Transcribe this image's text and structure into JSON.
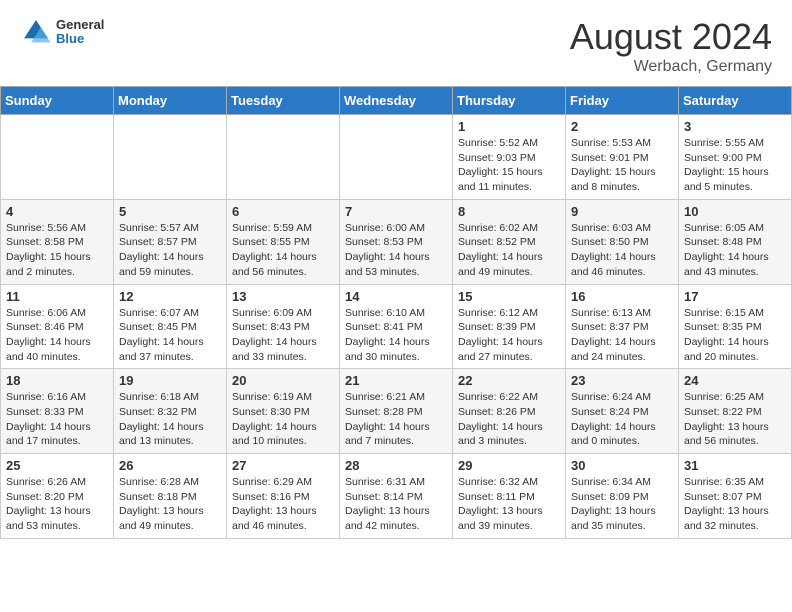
{
  "header": {
    "logo": {
      "general": "General",
      "blue": "Blue"
    },
    "month_year": "August 2024",
    "location": "Werbach, Germany"
  },
  "days_of_week": [
    "Sunday",
    "Monday",
    "Tuesday",
    "Wednesday",
    "Thursday",
    "Friday",
    "Saturday"
  ],
  "weeks": [
    [
      {
        "day": "",
        "info": ""
      },
      {
        "day": "",
        "info": ""
      },
      {
        "day": "",
        "info": ""
      },
      {
        "day": "",
        "info": ""
      },
      {
        "day": "1",
        "info": "Sunrise: 5:52 AM\nSunset: 9:03 PM\nDaylight: 15 hours and 11 minutes."
      },
      {
        "day": "2",
        "info": "Sunrise: 5:53 AM\nSunset: 9:01 PM\nDaylight: 15 hours and 8 minutes."
      },
      {
        "day": "3",
        "info": "Sunrise: 5:55 AM\nSunset: 9:00 PM\nDaylight: 15 hours and 5 minutes."
      }
    ],
    [
      {
        "day": "4",
        "info": "Sunrise: 5:56 AM\nSunset: 8:58 PM\nDaylight: 15 hours and 2 minutes."
      },
      {
        "day": "5",
        "info": "Sunrise: 5:57 AM\nSunset: 8:57 PM\nDaylight: 14 hours and 59 minutes."
      },
      {
        "day": "6",
        "info": "Sunrise: 5:59 AM\nSunset: 8:55 PM\nDaylight: 14 hours and 56 minutes."
      },
      {
        "day": "7",
        "info": "Sunrise: 6:00 AM\nSunset: 8:53 PM\nDaylight: 14 hours and 53 minutes."
      },
      {
        "day": "8",
        "info": "Sunrise: 6:02 AM\nSunset: 8:52 PM\nDaylight: 14 hours and 49 minutes."
      },
      {
        "day": "9",
        "info": "Sunrise: 6:03 AM\nSunset: 8:50 PM\nDaylight: 14 hours and 46 minutes."
      },
      {
        "day": "10",
        "info": "Sunrise: 6:05 AM\nSunset: 8:48 PM\nDaylight: 14 hours and 43 minutes."
      }
    ],
    [
      {
        "day": "11",
        "info": "Sunrise: 6:06 AM\nSunset: 8:46 PM\nDaylight: 14 hours and 40 minutes."
      },
      {
        "day": "12",
        "info": "Sunrise: 6:07 AM\nSunset: 8:45 PM\nDaylight: 14 hours and 37 minutes."
      },
      {
        "day": "13",
        "info": "Sunrise: 6:09 AM\nSunset: 8:43 PM\nDaylight: 14 hours and 33 minutes."
      },
      {
        "day": "14",
        "info": "Sunrise: 6:10 AM\nSunset: 8:41 PM\nDaylight: 14 hours and 30 minutes."
      },
      {
        "day": "15",
        "info": "Sunrise: 6:12 AM\nSunset: 8:39 PM\nDaylight: 14 hours and 27 minutes."
      },
      {
        "day": "16",
        "info": "Sunrise: 6:13 AM\nSunset: 8:37 PM\nDaylight: 14 hours and 24 minutes."
      },
      {
        "day": "17",
        "info": "Sunrise: 6:15 AM\nSunset: 8:35 PM\nDaylight: 14 hours and 20 minutes."
      }
    ],
    [
      {
        "day": "18",
        "info": "Sunrise: 6:16 AM\nSunset: 8:33 PM\nDaylight: 14 hours and 17 minutes."
      },
      {
        "day": "19",
        "info": "Sunrise: 6:18 AM\nSunset: 8:32 PM\nDaylight: 14 hours and 13 minutes."
      },
      {
        "day": "20",
        "info": "Sunrise: 6:19 AM\nSunset: 8:30 PM\nDaylight: 14 hours and 10 minutes."
      },
      {
        "day": "21",
        "info": "Sunrise: 6:21 AM\nSunset: 8:28 PM\nDaylight: 14 hours and 7 minutes."
      },
      {
        "day": "22",
        "info": "Sunrise: 6:22 AM\nSunset: 8:26 PM\nDaylight: 14 hours and 3 minutes."
      },
      {
        "day": "23",
        "info": "Sunrise: 6:24 AM\nSunset: 8:24 PM\nDaylight: 14 hours and 0 minutes."
      },
      {
        "day": "24",
        "info": "Sunrise: 6:25 AM\nSunset: 8:22 PM\nDaylight: 13 hours and 56 minutes."
      }
    ],
    [
      {
        "day": "25",
        "info": "Sunrise: 6:26 AM\nSunset: 8:20 PM\nDaylight: 13 hours and 53 minutes."
      },
      {
        "day": "26",
        "info": "Sunrise: 6:28 AM\nSunset: 8:18 PM\nDaylight: 13 hours and 49 minutes."
      },
      {
        "day": "27",
        "info": "Sunrise: 6:29 AM\nSunset: 8:16 PM\nDaylight: 13 hours and 46 minutes."
      },
      {
        "day": "28",
        "info": "Sunrise: 6:31 AM\nSunset: 8:14 PM\nDaylight: 13 hours and 42 minutes."
      },
      {
        "day": "29",
        "info": "Sunrise: 6:32 AM\nSunset: 8:11 PM\nDaylight: 13 hours and 39 minutes."
      },
      {
        "day": "30",
        "info": "Sunrise: 6:34 AM\nSunset: 8:09 PM\nDaylight: 13 hours and 35 minutes."
      },
      {
        "day": "31",
        "info": "Sunrise: 6:35 AM\nSunset: 8:07 PM\nDaylight: 13 hours and 32 minutes."
      }
    ]
  ]
}
